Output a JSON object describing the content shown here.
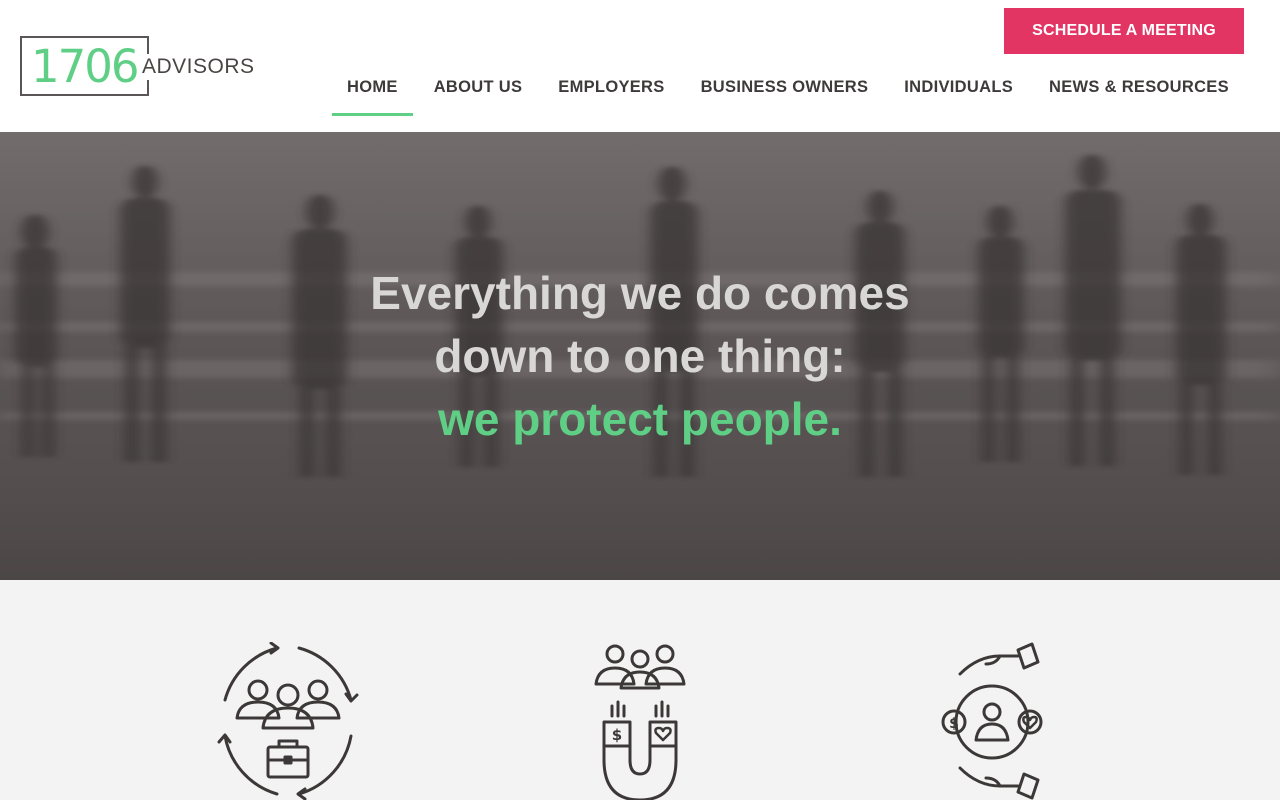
{
  "logo": {
    "number": "1706",
    "word": "ADVISORS"
  },
  "header": {
    "cta_label": "SCHEDULE A MEETING"
  },
  "nav": {
    "items": [
      {
        "label": "HOME"
      },
      {
        "label": "ABOUT US"
      },
      {
        "label": "EMPLOYERS"
      },
      {
        "label": "BUSINESS OWNERS"
      },
      {
        "label": "INDIVIDUALS"
      },
      {
        "label": "NEWS & RESOURCES"
      }
    ],
    "active_index": 0
  },
  "hero": {
    "line1": "Everything we do comes",
    "line2": "down to one thing:",
    "line3": "we protect people."
  },
  "features": {
    "icons": [
      "team-cycle-icon",
      "talent-magnet-icon",
      "care-hands-icon"
    ]
  },
  "colors": {
    "accent_green": "#5fcf86",
    "cta_pink": "#e33564",
    "text_dark": "#3e3a3a",
    "hero_overlay": "#5d5757",
    "section_bg": "#f3f3f3"
  }
}
